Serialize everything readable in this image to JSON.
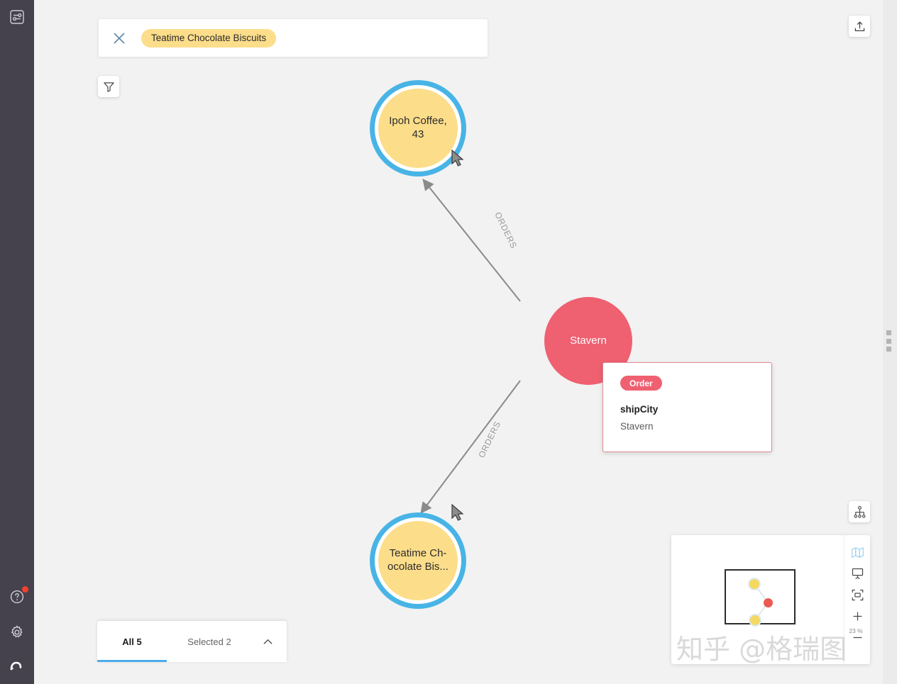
{
  "app": {
    "canvas_bg": "#f2f2f2",
    "rail_bg": "#45424e",
    "accent_blue": "#48b4e6",
    "node_yellow": "#fcdd8a",
    "node_red": "#ef6071",
    "notification_color": "#f3402d"
  },
  "rail": {
    "items": [
      {
        "icon": "sliders-icon",
        "label": "Sliders"
      },
      {
        "icon": "help-icon",
        "label": "Help",
        "badge": true
      },
      {
        "icon": "gear-icon",
        "label": "Settings"
      },
      {
        "icon": "logo-icon",
        "label": "Logo"
      }
    ]
  },
  "search": {
    "close_label": "×",
    "chip_label": "Teatime Chocolate Biscuits"
  },
  "toolbar": {
    "filter_label": "Filter",
    "export_label": "Export",
    "collapse_label": "Collapse panel",
    "layout_label": "Layout"
  },
  "graph": {
    "nodes": [
      {
        "id": "ipoh",
        "label": "Ipoh Coffee,\n43",
        "line1": "Ipoh Coffee,",
        "line2": "43",
        "type": "Product",
        "color": "#fcdd8a",
        "selected": true
      },
      {
        "id": "stavern",
        "label": "Stavern",
        "line1": "Stavern",
        "line2": "",
        "type": "Order",
        "color": "#ef6071",
        "selected": false
      },
      {
        "id": "teatime",
        "label": "Teatime Ch-\nocolate Bis...",
        "line1": "Teatime Ch-",
        "line2": "ocolate Bis...",
        "type": "Product",
        "color": "#fcdd8a",
        "selected": true
      }
    ],
    "edges": [
      {
        "label": "ORDERS",
        "from": "stavern",
        "to": "ipoh"
      },
      {
        "label": "ORDERS",
        "from": "stavern",
        "to": "teatime"
      }
    ]
  },
  "inspector": {
    "badge": "Order",
    "property_key": "shipCity",
    "property_value": "Stavern"
  },
  "tabs": {
    "all_label": "All 5",
    "selected_label": "Selected 2",
    "collapse_label": "Collapse"
  },
  "minimap": {
    "zoom_label": "23 %",
    "tools": [
      {
        "icon": "map-icon",
        "label": "Minimap",
        "active": true
      },
      {
        "icon": "fit-icon",
        "label": "Fit to window",
        "active": false
      },
      {
        "icon": "frame-icon",
        "label": "Reset view",
        "active": false
      },
      {
        "icon": "plus-icon",
        "label": "Zoom in",
        "active": false
      },
      {
        "icon": "minus-icon",
        "label": "Zoom out",
        "active": false
      }
    ]
  },
  "watermark": {
    "text": "知乎 @格瑞图"
  }
}
